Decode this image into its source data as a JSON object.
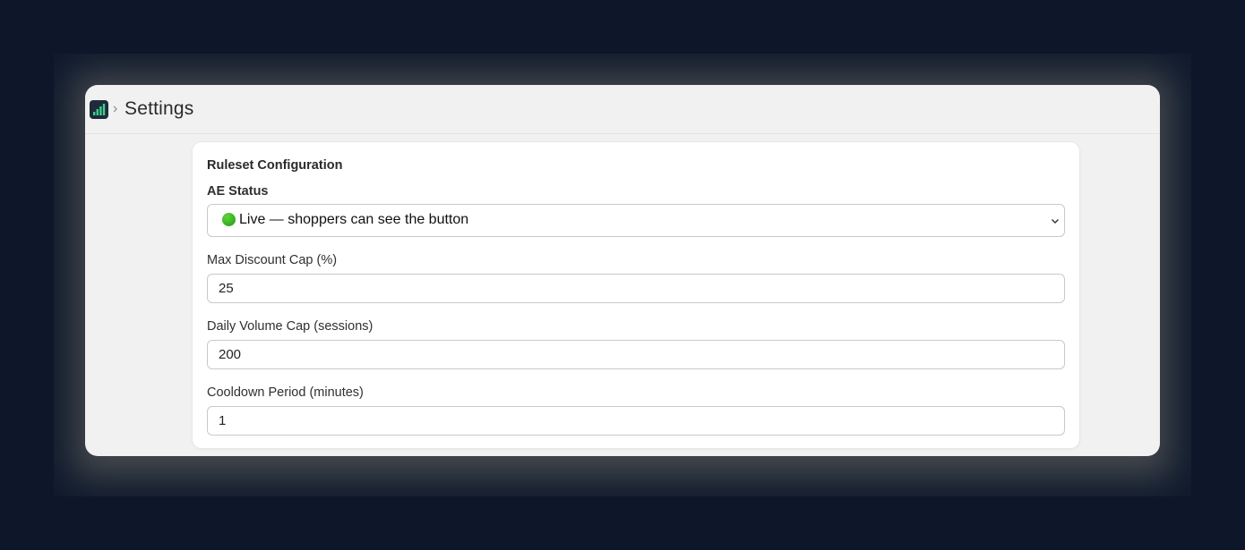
{
  "header": {
    "separator": "›",
    "title": "Settings"
  },
  "card": {
    "title": "Ruleset Configuration",
    "ae_status": {
      "label": "AE Status",
      "selected": "Live — shoppers can see the button",
      "status_color": "#2eb81a"
    },
    "max_discount": {
      "label": "Max Discount Cap (%)",
      "value": "25"
    },
    "daily_volume": {
      "label": "Daily Volume Cap (sessions)",
      "value": "200"
    },
    "cooldown": {
      "label": "Cooldown Period (minutes)",
      "value": "1"
    }
  },
  "icons": {
    "app": "signal-bars-icon",
    "select_arrow": "chevron-down-icon"
  }
}
